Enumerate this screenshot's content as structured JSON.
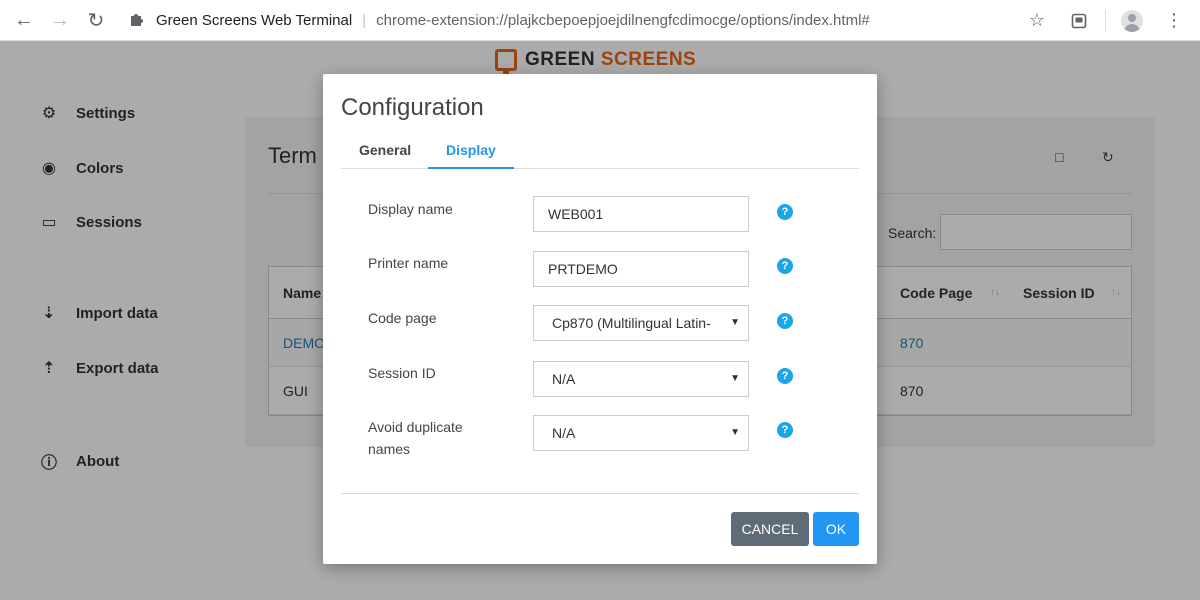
{
  "browser": {
    "tab_title": "Green Screens Web Terminal",
    "url": "chrome-extension://plajkcbepoepjoejdilnengfcdimocge/options/index.html#"
  },
  "app": {
    "logo": {
      "part1": "GREEN",
      "part2": "SCREENS"
    },
    "sidebar": [
      {
        "label": "Settings",
        "icon": "gear-icon"
      },
      {
        "label": "Colors",
        "icon": "eye-icon"
      },
      {
        "label": "Sessions",
        "icon": "monitor-icon"
      },
      {
        "label": "Import data",
        "icon": "download-icon"
      },
      {
        "label": "Export data",
        "icon": "upload-icon"
      },
      {
        "label": "About",
        "icon": "info-icon"
      }
    ],
    "panel": {
      "title": "Term",
      "search_label": "Search:",
      "columns": [
        "Name",
        "Code Page",
        "Session ID"
      ],
      "rows": [
        {
          "name": "DEMO",
          "code_page": "870"
        },
        {
          "name": "GUI",
          "code_page": "870"
        }
      ]
    }
  },
  "modal": {
    "title": "Configuration",
    "tabs": [
      "General",
      "Display"
    ],
    "active_tab": "Display",
    "fields": [
      {
        "label": "Display name",
        "type": "input",
        "value": "WEB001"
      },
      {
        "label": "Printer name",
        "type": "input",
        "value": "PRTDEMO"
      },
      {
        "label": "Code page",
        "type": "select",
        "value": "Cp870 (Multilingual Latin-"
      },
      {
        "label": "Session ID",
        "type": "select",
        "value": "N/A"
      },
      {
        "label": "Avoid duplicate names",
        "type": "select",
        "value": "N/A"
      }
    ],
    "help_glyph": "?",
    "buttons": {
      "cancel": "CANCEL",
      "ok": "OK"
    }
  },
  "colors": {
    "accent": "#2196f3",
    "brand": "#e8661b",
    "help": "#1ba6e8",
    "cancel": "#5f6b77"
  }
}
